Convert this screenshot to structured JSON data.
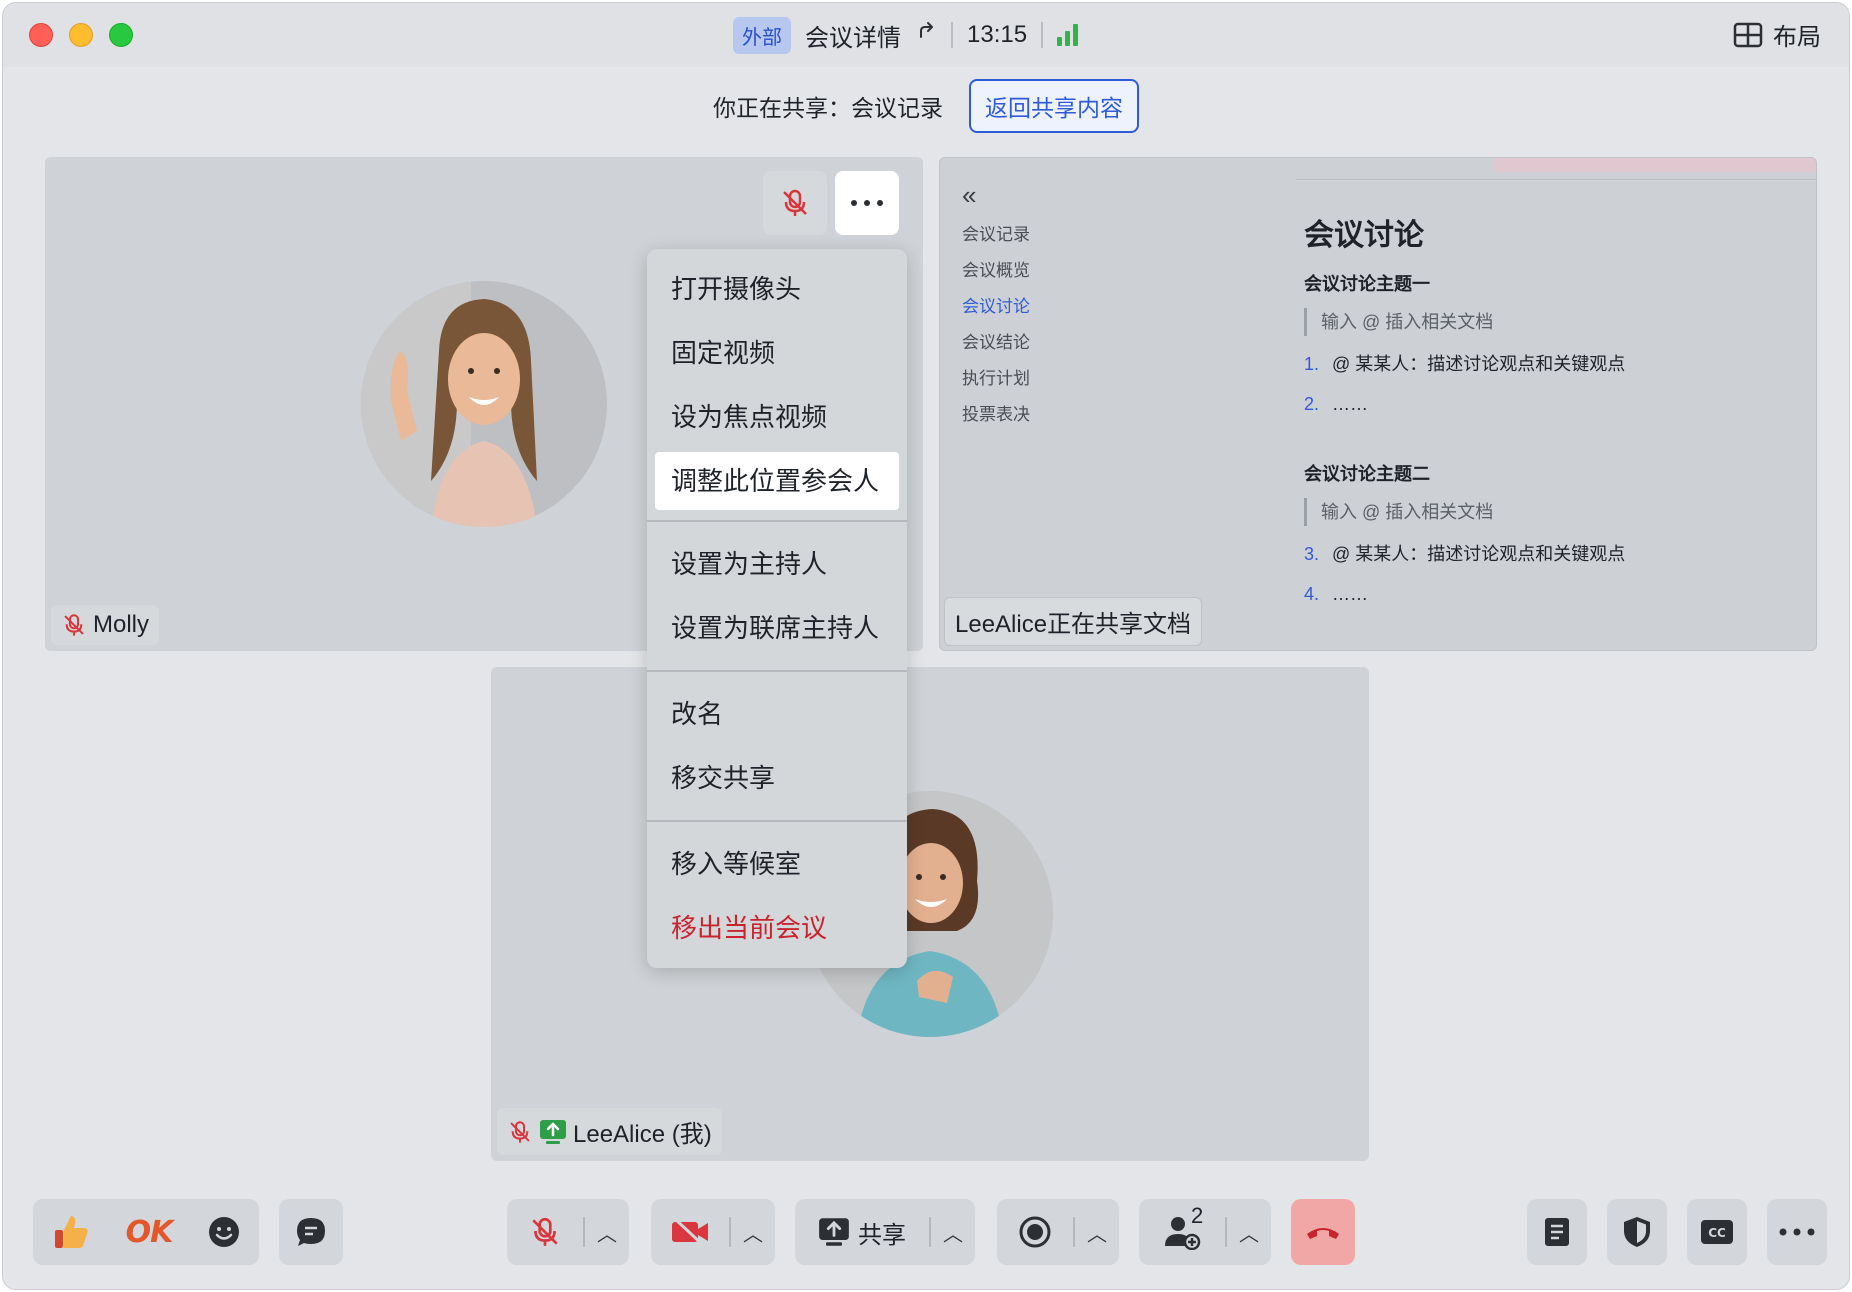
{
  "titlebar": {
    "badge": "外部",
    "meeting_title": "会议详情",
    "time": "13:15",
    "layout_label": "布局"
  },
  "share_banner": {
    "text": "你正在共享：会议记录",
    "back_button": "返回共享内容"
  },
  "tiles": {
    "molly": {
      "name": "Molly"
    },
    "doc": {
      "share_label": "LeeAlice正在共享文档",
      "nav": [
        "会议记录",
        "会议概览",
        "会议讨论",
        "会议结论",
        "执行计划",
        "投票表决"
      ],
      "active_nav_index": 2,
      "heading": "会议讨论",
      "topic1": "会议讨论主题一",
      "topic2": "会议讨论主题二",
      "quote_placeholder": "输入 @ 插入相关文档",
      "item_text": "@ 某某人：描述讨论观点和关键观点",
      "ellipsis": "……",
      "nums": [
        "1.",
        "2.",
        "3.",
        "4."
      ]
    },
    "lee": {
      "name": "LeeAlice (我)"
    }
  },
  "menu": {
    "items": [
      "打开摄像头",
      "固定视频",
      "设为焦点视频",
      "调整此位置参会人",
      "设置为主持人",
      "设置为联席主持人",
      "改名",
      "移交共享",
      "移入等候室",
      "移出当前会议"
    ]
  },
  "toolbar": {
    "ok": "OK",
    "share_label": "共享",
    "participants_count": "2"
  },
  "colors": {
    "accent": "#2f5bd8",
    "danger": "#c9242e",
    "hangup": "#f0a7a5",
    "signal": "#34b34a"
  }
}
